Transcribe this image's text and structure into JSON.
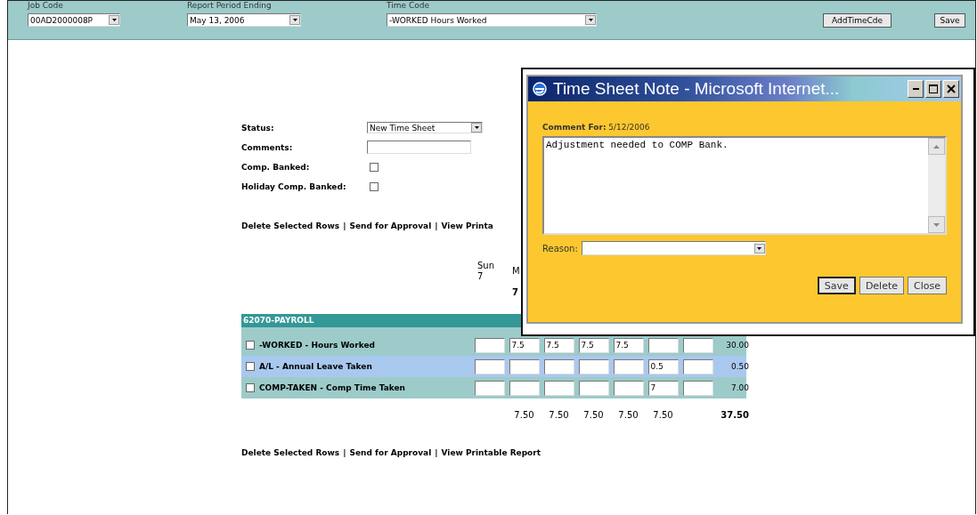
{
  "toolbar": {
    "fields": [
      {
        "label": "Job Code",
        "value": "00AD2000008P",
        "kind": "select"
      },
      {
        "label": "Report Period Ending",
        "value": "May 13, 2006",
        "kind": "select"
      },
      {
        "label": "Time Code",
        "value": "-WORKED Hours Worked",
        "kind": "select"
      }
    ],
    "buttons": [
      "AddTimeCde",
      "Save"
    ]
  },
  "form": {
    "status": {
      "label": "Status:",
      "value": "New Time Sheet"
    },
    "comments": {
      "label": "Comments:"
    },
    "checkboxes": [
      {
        "label": "Comp. Banked:",
        "checked": false
      },
      {
        "label": "Holiday Comp. Banked:",
        "checked": false
      }
    ]
  },
  "links_top": {
    "items": [
      "Delete Selected Rows",
      "Send for Approval",
      "View Printa"
    ],
    "separator": "|"
  },
  "day_headers": [
    {
      "day": "Sun",
      "date": "7"
    },
    {
      "day": "M",
      "total": "7"
    }
  ],
  "table": {
    "group": "62070-PAYROLL",
    "rows": [
      {
        "label": "-WORKED - Hours Worked",
        "checked": false,
        "selected": false,
        "hours": [
          {
            "kind": "empty"
          },
          {
            "kind": "value",
            "value": "7.5"
          },
          {
            "kind": "value",
            "value": "7.5"
          },
          {
            "kind": "value",
            "value": "7.5"
          },
          {
            "kind": "value",
            "value": "7.5"
          },
          {
            "kind": "empty"
          },
          {
            "kind": "empty"
          }
        ],
        "total": "30.00"
      },
      {
        "label": "A/L - Annual Leave Taken",
        "checked": false,
        "selected": true,
        "hours": [
          {
            "kind": "empty"
          },
          {
            "kind": "empty"
          },
          {
            "kind": "empty"
          },
          {
            "kind": "empty"
          },
          {
            "kind": "empty"
          },
          {
            "kind": "value",
            "value": "0.5"
          },
          {
            "kind": "empty"
          }
        ],
        "total": "0.50"
      },
      {
        "label": "COMP-TAKEN - Comp Time Taken",
        "checked": false,
        "selected": false,
        "hours": [
          {
            "kind": "empty"
          },
          {
            "kind": "empty"
          },
          {
            "kind": "empty"
          },
          {
            "kind": "empty"
          },
          {
            "kind": "empty"
          },
          {
            "kind": "value",
            "value": "7"
          },
          {
            "kind": "empty"
          }
        ],
        "total": "7.00"
      }
    ],
    "totals": [
      {
        "kind": "empty"
      },
      {
        "kind": "value",
        "value": "7.50"
      },
      {
        "kind": "value",
        "value": "7.50"
      },
      {
        "kind": "value",
        "value": "7.50"
      },
      {
        "kind": "value",
        "value": "7.50"
      },
      {
        "kind": "value",
        "value": "7.50"
      },
      {
        "kind": "empty"
      }
    ],
    "grand_total": "37.50"
  },
  "links_bottom": {
    "items": [
      "Delete Selected Rows",
      "Send for Approval",
      "View Printable Report"
    ],
    "separator": "|"
  },
  "dialog": {
    "title": "Time Sheet Note - Microsoft Internet...",
    "comment_label": "Comment For:",
    "comment_date": "5/12/2006",
    "comment": "Adjustment needed to COMP Bank.",
    "reason_label": "Reason:",
    "buttons": [
      {
        "label": "Save",
        "default": true
      },
      {
        "label": "Delete",
        "default": false
      },
      {
        "label": "Close",
        "default": false
      }
    ]
  }
}
